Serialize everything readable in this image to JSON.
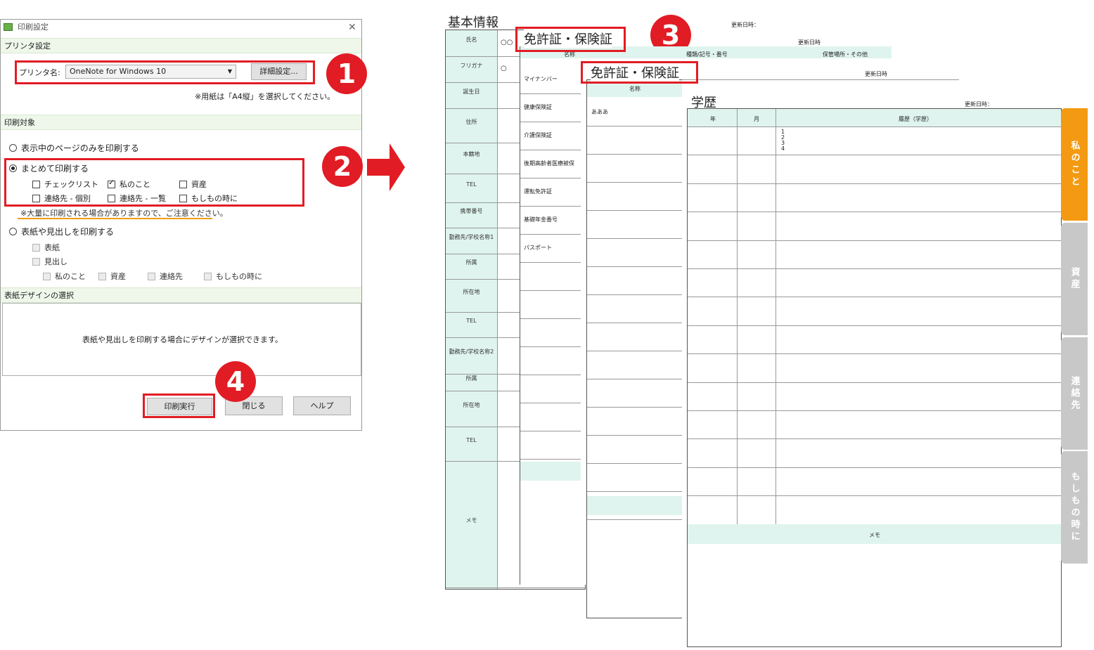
{
  "dialog": {
    "title": "印刷設定",
    "printer_section": "プリンタ設定",
    "printer_label": "プリンタ名:",
    "printer_value": "OneNote for Windows 10",
    "detail_button": "詳細設定...",
    "paper_note": "※用紙は「A4縦」を選択してください。",
    "target_section": "印刷対象",
    "radio_current": "表示中のページのみを印刷する",
    "radio_batch": "まとめて印刷する",
    "batch_options": [
      "チェックリスト",
      "私のこと",
      "資産",
      "連絡先 - 個別",
      "連絡先 - 一覧",
      "もしもの時に"
    ],
    "batch_checked": "私のこと",
    "warning": "※大量に印刷される場合がありますので、ご注意ください。",
    "radio_cover": "表紙や見出しを印刷する",
    "cover_option": "表紙",
    "heading_option": "見出し",
    "heading_sub": [
      "私のこと",
      "資産",
      "連絡先",
      "もしもの時に"
    ],
    "design_section": "表紙デザインの選択",
    "design_note": "表紙や見出しを印刷する場合にデザインが選択できます。",
    "print_button": "印刷実行",
    "close_button": "閉じる",
    "help_button": "ヘルプ"
  },
  "badges": [
    "1",
    "2",
    "3",
    "4"
  ],
  "page_basic": {
    "title": "基本情報",
    "name_value": "○○",
    "furigana_value": "○",
    "rows": [
      "氏名",
      "フリガナ",
      "誕生日",
      "住所",
      "本籍地",
      "TEL",
      "携帯番号",
      "勤務先/学校名称1",
      "所属",
      "所在地",
      "TEL",
      "勤務先/学校名称2",
      "所属",
      "所在地",
      "TEL",
      "メモ"
    ]
  },
  "page_license1": {
    "title": "免許証・保険証",
    "updated": "更新日時：",
    "updated2": "更新日時",
    "col_name": "名称",
    "col_number": "種類/記号・番号",
    "col_place": "保管場所・その他",
    "rows": [
      "マイナンバー",
      "健康保険証",
      "介護保険証",
      "後期高齢者医療被保",
      "運転免許証",
      "基礎年金番号",
      "パスポート"
    ]
  },
  "page_license2": {
    "title": "免許証・保険証",
    "updated": "更新日時",
    "col_name": "名称",
    "first_value": "あああ"
  },
  "page_education": {
    "title": "学歴",
    "updated": "更新日時：",
    "col_year": "年",
    "col_month": "月",
    "col_history": "履歴（学歴）",
    "history_lines": [
      "1",
      "2",
      "3",
      "4"
    ],
    "memo": "メモ"
  },
  "side_tabs": [
    {
      "label": "私のこと",
      "color": "#f39a12"
    },
    {
      "label": "資産",
      "color": "#c8c8c8"
    },
    {
      "label": "連絡先",
      "color": "#c8c8c8"
    },
    {
      "label": "もしもの時に",
      "color": "#c8c8c8"
    }
  ],
  "colors": {
    "accent_red": "#e21c24",
    "mint": "#dff4ee",
    "orange_tab": "#f39a12",
    "gray_tab": "#c8c8c8"
  }
}
